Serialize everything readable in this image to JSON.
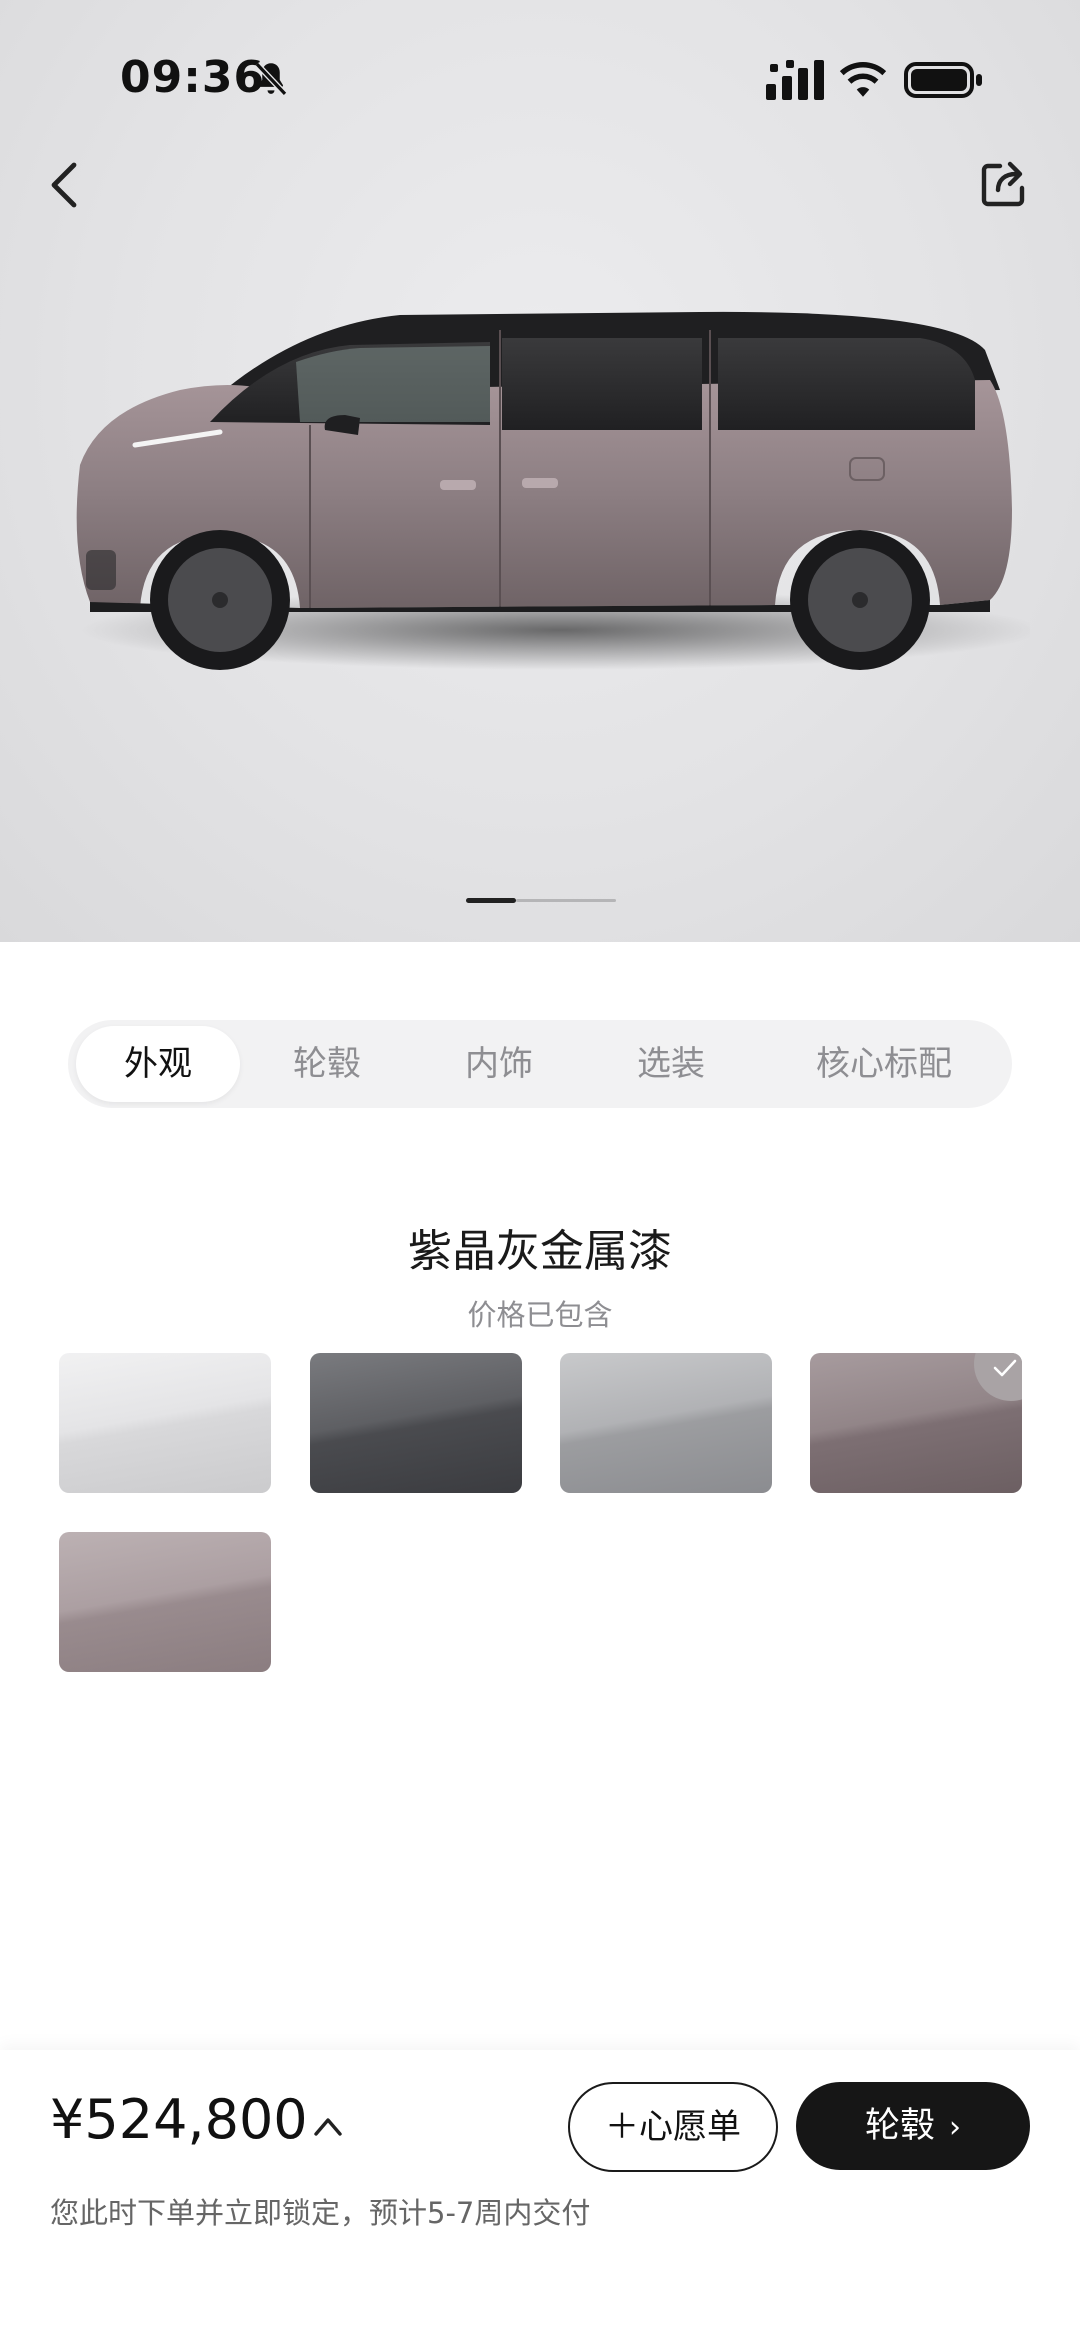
{
  "status_bar": {
    "time": "09:36",
    "icons": [
      "bell-off-icon",
      "signal-icon",
      "wifi-icon",
      "battery-icon"
    ]
  },
  "header": {
    "back_icon": "chevron-left-icon",
    "share_icon": "share-icon"
  },
  "hero": {
    "image": "car-side-view",
    "page_count": 2,
    "active_page": 1
  },
  "tabs": [
    {
      "label": "外观",
      "active": true
    },
    {
      "label": "轮毂",
      "active": false
    },
    {
      "label": "内饰",
      "active": false
    },
    {
      "label": "选装",
      "active": false
    },
    {
      "label": "核心标配",
      "active": false
    }
  ],
  "color_section": {
    "selected_name": "紫晶灰金属漆",
    "note": "价格已包含",
    "swatches": [
      {
        "color": "#e2e2e4",
        "selected": false
      },
      {
        "color": "#56575b",
        "selected": false
      },
      {
        "color": "#a7a8ab",
        "selected": false
      },
      {
        "color": "#8a7b7f",
        "selected": true
      },
      {
        "color": "#a79a9c",
        "selected": false
      }
    ]
  },
  "footer": {
    "price": "¥524,800",
    "delivery_note": "您此时下单并立即锁定，预计5-7周内交付",
    "wishlist_label": "＋心愿单",
    "next_label": "轮毂"
  },
  "colors": {
    "primary_button": "#161616",
    "text_muted": "#8e8e92",
    "car_body": "#8c7e82"
  }
}
